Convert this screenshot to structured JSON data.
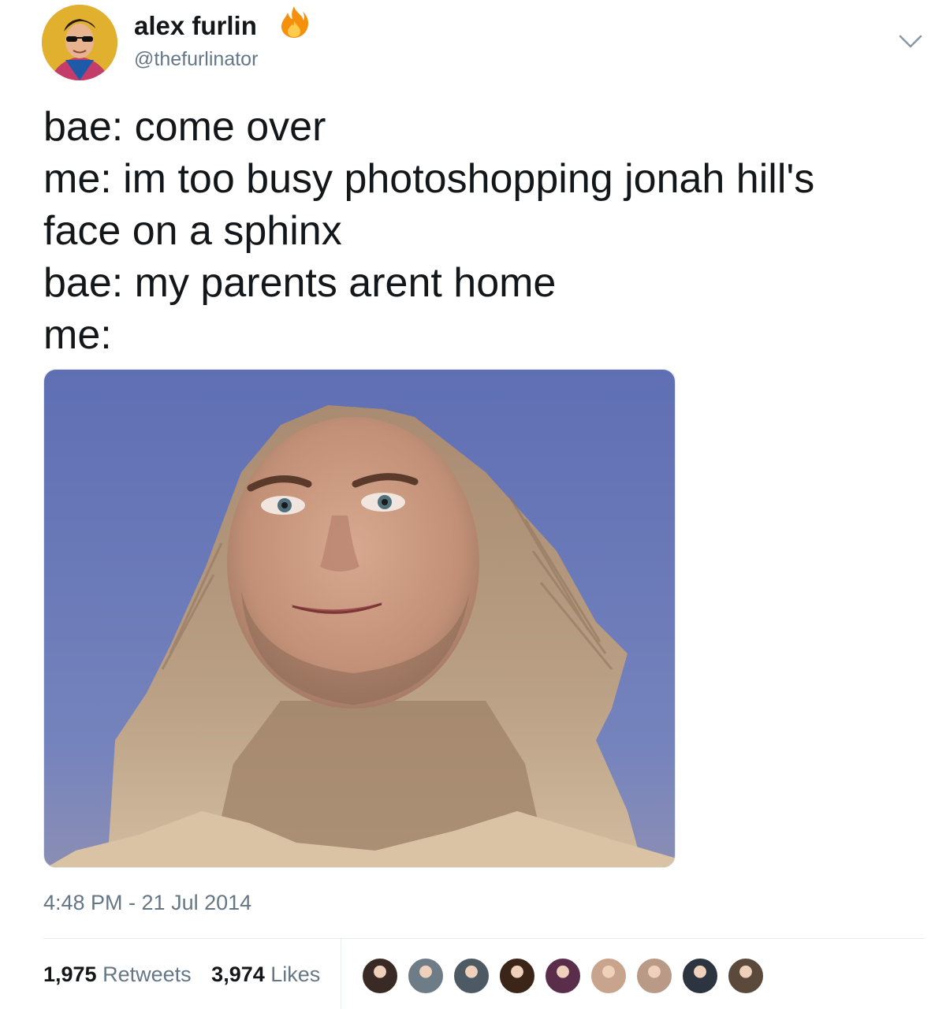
{
  "author": {
    "display_name": "alex furlin",
    "handle": "@thefurlinator",
    "emoji_icon": "fire-icon",
    "avatar_icon": "avatar-photo"
  },
  "header": {
    "menu_icon": "chevron-down-icon"
  },
  "tweet": {
    "lines": [
      "bae: come over",
      "me: im too busy photoshopping jonah hill's",
      "face on a sphinx",
      "bae: my parents arent home",
      "me:"
    ],
    "media": {
      "type": "photo",
      "icon": "sphinx-photo"
    }
  },
  "meta": {
    "timestamp": "4:48 PM - 21 Jul 2014"
  },
  "stats": {
    "retweets_count": "1,975",
    "retweets_label": "Retweets",
    "likes_count": "3,974",
    "likes_label": "Likes"
  },
  "likers": {
    "count_shown": 9,
    "avatar_colors": [
      "#3a2a26",
      "#6d7c86",
      "#4e5a63",
      "#3b2418",
      "#5a2d4a",
      "#c9a48c",
      "#b89a86",
      "#2c3440",
      "#5b4a3c"
    ]
  },
  "colors": {
    "text_primary": "#14171a",
    "text_secondary": "#657786",
    "sky": "#6472b4",
    "stone": "#b89a78"
  }
}
